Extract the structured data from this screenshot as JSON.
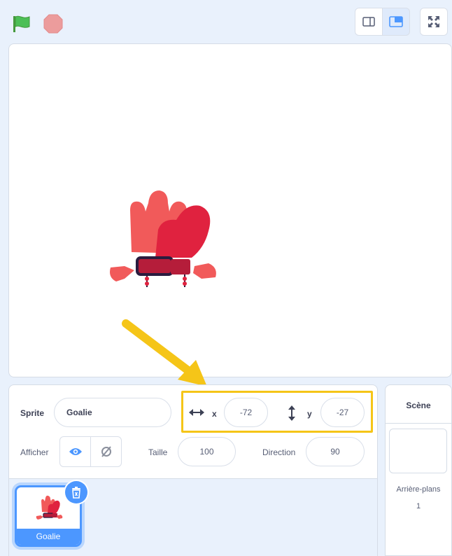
{
  "top_bar": {
    "green_flag_icon": "green-flag-icon",
    "stop_icon": "stop-icon",
    "view_buttons": [
      "small-stage-icon",
      "normal-stage-icon",
      "fullscreen-icon"
    ]
  },
  "stage": {
    "sprite_icon": "goalie-glove"
  },
  "sprite_info": {
    "sprite_label": "Sprite",
    "sprite_name": "Goalie",
    "x_label": "x",
    "x_value": "-72",
    "y_label": "y",
    "y_value": "-27",
    "show_label": "Afficher",
    "size_label": "Taille",
    "size_value": "100",
    "direction_label": "Direction",
    "direction_value": "90"
  },
  "sprite_list": [
    {
      "name": "Goalie",
      "selected": true
    }
  ],
  "stage_selector": {
    "title": "Scène",
    "backdrops_label": "Arrière-plans",
    "backdrops_count": "1"
  },
  "colors": {
    "accent": "#4c97ff",
    "highlight": "#f5c518",
    "flag": "#4cbf56",
    "stop": "#ec9c9c"
  }
}
